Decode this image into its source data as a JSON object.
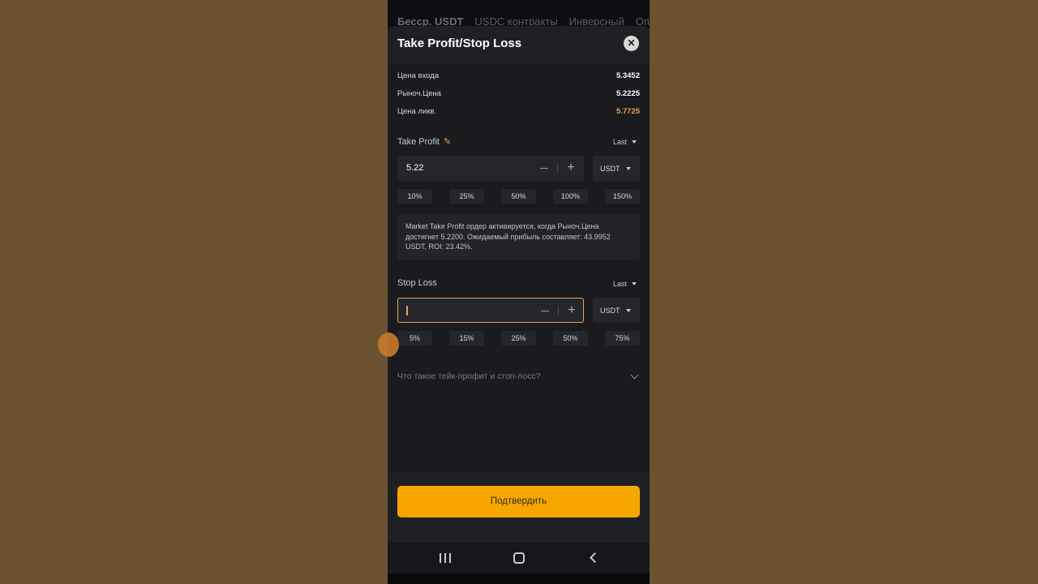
{
  "background_tabs": [
    "Бесср. USDT",
    "USDC контракты",
    "Инверсный",
    "Опц"
  ],
  "modal": {
    "title": "Take Profit/Stop Loss",
    "close_icon": "close-icon"
  },
  "info": [
    {
      "label": "Цена входа",
      "value": "5.3452",
      "color": "#ffffff"
    },
    {
      "label": "Рыноч.Цена",
      "value": "5.2225",
      "color": "#ffffff"
    },
    {
      "label": "Цена ликв.",
      "value": "5.7725",
      "color": "#e8a24a"
    }
  ],
  "take_profit": {
    "label": "Take Profit",
    "trigger": "Last",
    "value": "5.22",
    "unit": "USDT",
    "percents": [
      "10%",
      "25%",
      "50%",
      "100%",
      "150%"
    ],
    "hint": "Market Take Profit ордер активируется, когда Рыноч.Цена достигнет 5.2200. Ожидаемый прибыль составляет: 43.9952 USDT, ROI: 23.42%."
  },
  "stop_loss": {
    "label": "Stop Loss",
    "trigger": "Last",
    "value": "",
    "unit": "USDT",
    "percents": [
      "5%",
      "15%",
      "25%",
      "50%",
      "75%"
    ]
  },
  "faq": {
    "label": "Что такое тейк-профит и стоп-лосс?"
  },
  "confirm_label": "Подтвердить",
  "colors": {
    "accent": "#f7a600",
    "liq_price": "#e8a24a",
    "page_bg": "#6b522f"
  }
}
